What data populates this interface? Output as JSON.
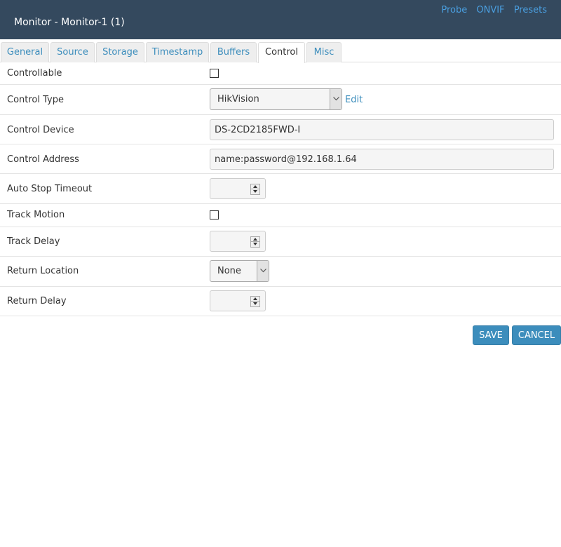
{
  "header": {
    "title": "Monitor - Monitor-1 (1)",
    "links": [
      "Probe",
      "ONVIF",
      "Presets"
    ]
  },
  "tabs": [
    {
      "label": "General"
    },
    {
      "label": "Source"
    },
    {
      "label": "Storage"
    },
    {
      "label": "Timestamp"
    },
    {
      "label": "Buffers"
    },
    {
      "label": "Control",
      "active": true
    },
    {
      "label": "Misc"
    }
  ],
  "form": {
    "controllable": {
      "label": "Controllable",
      "checked": false
    },
    "control_type": {
      "label": "Control Type",
      "value": "HikVision",
      "edit_label": "Edit"
    },
    "control_device": {
      "label": "Control Device",
      "value": "DS-2CD2185FWD-I"
    },
    "control_address": {
      "label": "Control Address",
      "value": "name:password@192.168.1.64"
    },
    "auto_stop_timeout": {
      "label": "Auto Stop Timeout",
      "value": ""
    },
    "track_motion": {
      "label": "Track Motion",
      "checked": false
    },
    "track_delay": {
      "label": "Track Delay",
      "value": ""
    },
    "return_location": {
      "label": "Return Location",
      "value": "None"
    },
    "return_delay": {
      "label": "Return Delay",
      "value": ""
    }
  },
  "buttons": {
    "save": "SAVE",
    "cancel": "CANCEL"
  },
  "colors": {
    "header_bg": "#34495e",
    "accent": "#3c8dbc",
    "link": "#4a9fe0"
  }
}
